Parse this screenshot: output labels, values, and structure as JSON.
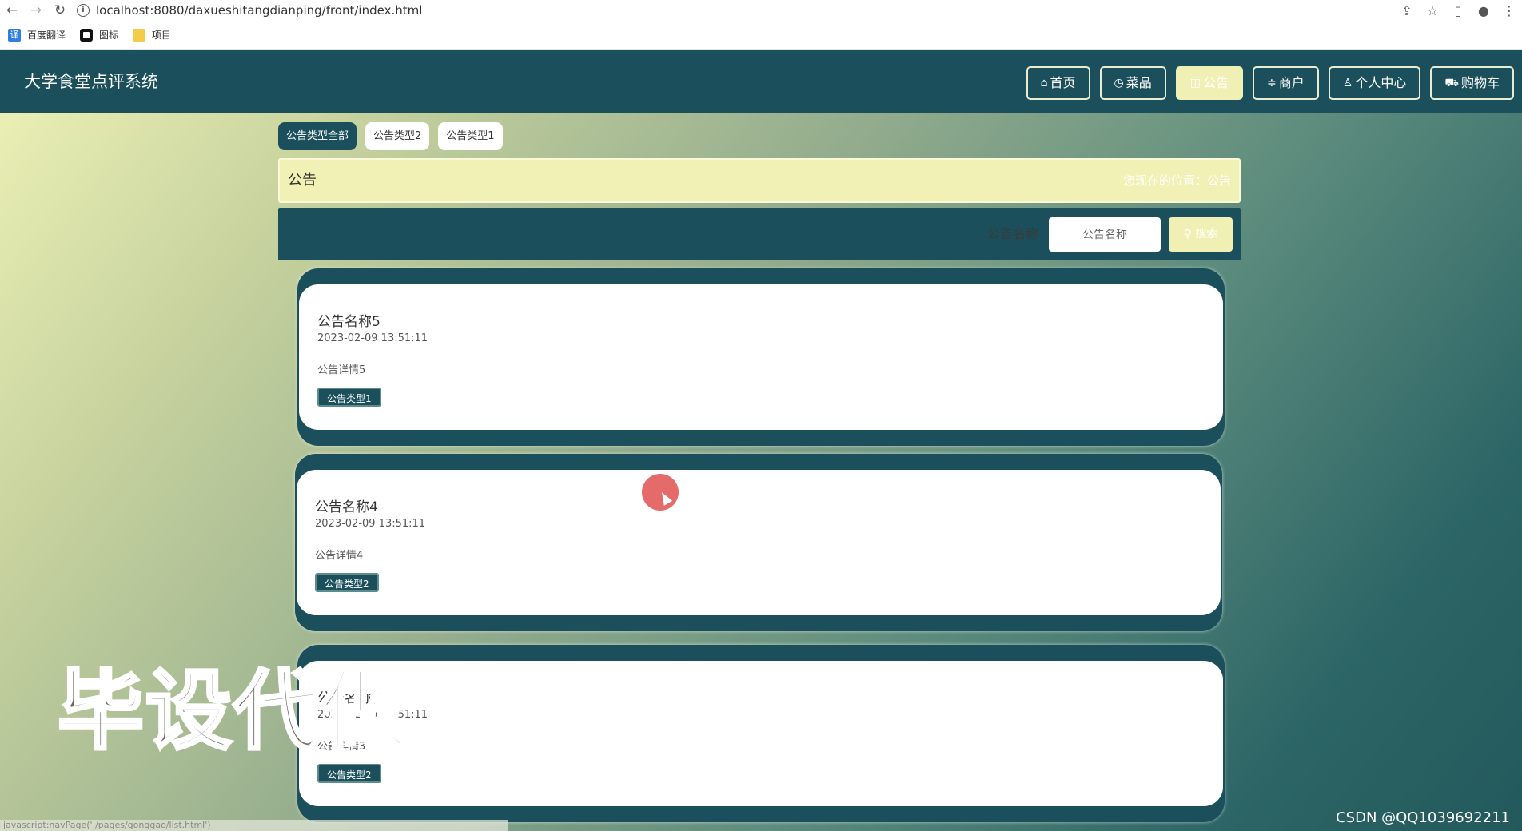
{
  "browser": {
    "url": "localhost:8080/daxueshitangdianping/front/index.html",
    "bookmarks": [
      {
        "label": "百度翻译",
        "icon": "translate-icon"
      },
      {
        "label": "图标",
        "icon": "image-icon"
      },
      {
        "label": "项目",
        "icon": "folder-icon"
      }
    ],
    "status_url": "javascript:navPage('./pages/gonggao/list.html')"
  },
  "header": {
    "title": "大学食堂点评系统",
    "menu": [
      {
        "label": "首页",
        "icon": "home-icon",
        "active": false
      },
      {
        "label": "菜品",
        "icon": "clock-icon",
        "active": false
      },
      {
        "label": "公告",
        "icon": "notice-icon",
        "active": true
      },
      {
        "label": "商户",
        "icon": "shop-icon",
        "active": false
      },
      {
        "label": "个人中心",
        "icon": "user-icon",
        "active": false
      },
      {
        "label": "购物车",
        "icon": "cart-icon",
        "active": false
      }
    ]
  },
  "tabs": [
    "公告类型全部",
    "公告类型2",
    "公告类型1"
  ],
  "breadcrumb": {
    "title": "公告",
    "location": "您现在的位置：公告"
  },
  "search": {
    "label": "公告名称",
    "placeholder": "公告名称",
    "button": "搜索"
  },
  "notices": [
    {
      "title": "公告名称5",
      "date": "2023-02-09 13:51:11",
      "desc": "公告详情5",
      "tag": "公告类型1"
    },
    {
      "title": "公告名称4",
      "date": "2023-02-09 13:51:11",
      "desc": "公告详情4",
      "tag": "公告类型2"
    },
    {
      "title": "公告名称3",
      "date": "2023-02-09 13:51:11",
      "desc": "公告详情3",
      "tag": "公告类型2"
    }
  ],
  "watermark": "毕设代做",
  "credit": "CSDN @QQ1039692211"
}
